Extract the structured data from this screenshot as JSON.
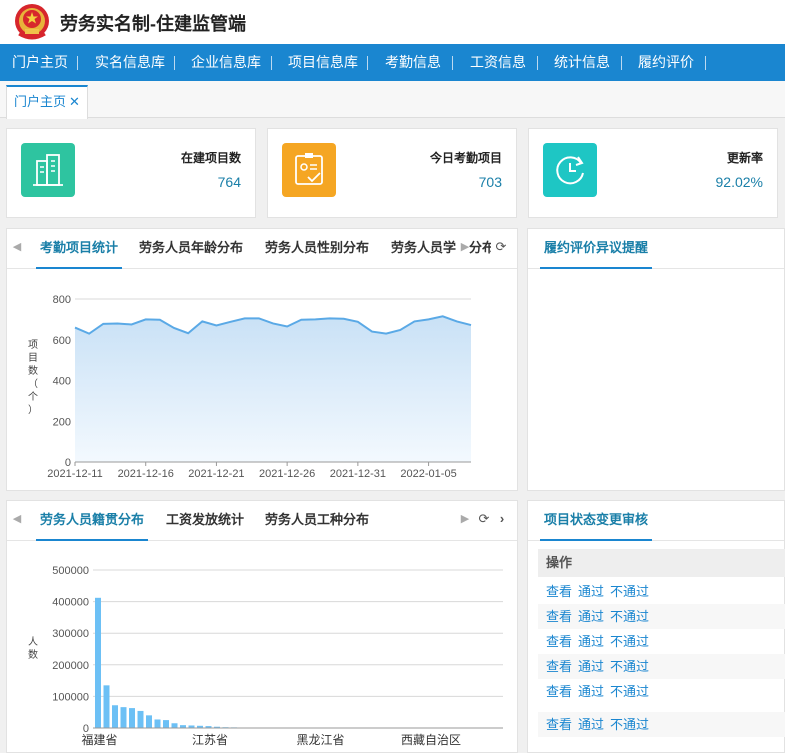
{
  "app": {
    "title": "劳务实名制-住建监管端"
  },
  "nav": {
    "items": [
      "门户主页",
      "实名信息库",
      "企业信息库",
      "项目信息库",
      "考勤信息",
      "工资信息",
      "统计信息",
      "履约评价"
    ]
  },
  "tabs": {
    "open": [
      {
        "label": "门户主页",
        "close": "✕"
      }
    ]
  },
  "stats": [
    {
      "label": "在建项目数",
      "value": "764",
      "icon": "building-icon",
      "color": "#2ec4a0"
    },
    {
      "label": "今日考勤项目",
      "value": "703",
      "icon": "attendance-icon",
      "color": "#f5a623"
    },
    {
      "label": "更新率",
      "value": "92.02%",
      "icon": "refresh-clock-icon",
      "color": "#1ec6c4"
    }
  ],
  "attendance_panel": {
    "tabs": [
      "考勤项目统计",
      "劳务人员年龄分布",
      "劳务人员性别分布",
      "劳务人员学",
      "分布"
    ]
  },
  "dispute_panel": {
    "tabs": [
      "履约评价异议提醒"
    ]
  },
  "origin_panel": {
    "tabs": [
      "劳务人员籍贯分布",
      "工资发放统计",
      "劳务人员工种分布"
    ]
  },
  "audit_panel": {
    "tabs": [
      "项目状态变更审核"
    ],
    "column": "操作",
    "rows": [
      [
        "查看",
        "通过",
        "不通过"
      ],
      [
        "查看",
        "通过",
        "不通过"
      ],
      [
        "查看",
        "通过",
        "不通过"
      ],
      [
        "查看",
        "通过",
        "不通过"
      ],
      [
        "查看",
        "通过",
        "不通过"
      ],
      [
        "查看",
        "通过",
        "不通过"
      ]
    ]
  },
  "chart_data": [
    {
      "type": "area",
      "xlabel": "",
      "ylabel": "项目数（个）",
      "ylim": [
        0,
        800
      ],
      "yticks": [
        0,
        200,
        400,
        600,
        800
      ],
      "xtick_labels": [
        "2021-12-11",
        "2021-12-16",
        "2021-12-21",
        "2021-12-26",
        "2021-12-31",
        "2022-01-05"
      ],
      "x": [
        "2021-12-11",
        "2021-12-12",
        "2021-12-13",
        "2021-12-14",
        "2021-12-15",
        "2021-12-16",
        "2021-12-17",
        "2021-12-18",
        "2021-12-19",
        "2021-12-20",
        "2021-12-21",
        "2021-12-22",
        "2021-12-23",
        "2021-12-24",
        "2021-12-25",
        "2021-12-26",
        "2021-12-27",
        "2021-12-28",
        "2021-12-29",
        "2021-12-30",
        "2021-12-31",
        "2022-01-01",
        "2022-01-02",
        "2022-01-03",
        "2022-01-04",
        "2022-01-05",
        "2022-01-06",
        "2022-01-07",
        "2022-01-08"
      ],
      "values": [
        660,
        630,
        678,
        680,
        675,
        700,
        698,
        658,
        632,
        690,
        670,
        688,
        705,
        705,
        680,
        665,
        698,
        700,
        705,
        703,
        688,
        640,
        630,
        648,
        690,
        700,
        715,
        690,
        672
      ],
      "colors": {
        "line": "#5aa9e6",
        "fill": "#d7eaf9"
      },
      "grid": true
    },
    {
      "type": "bar",
      "xlabel": "",
      "ylabel": "人数",
      "ylim": [
        0,
        500000
      ],
      "yticks": [
        0,
        100000,
        200000,
        300000,
        400000,
        500000
      ],
      "xtick_labels": [
        "福建省",
        "江苏省",
        "黑龙江省",
        "西藏自治区"
      ],
      "values": [
        412000,
        135000,
        72000,
        66000,
        63000,
        54000,
        40000,
        27000,
        25000,
        15000,
        9000,
        8000,
        7000,
        6000,
        4000,
        2500,
        2000,
        1500,
        1000,
        800,
        600,
        400,
        300,
        200,
        150,
        100,
        80,
        60,
        40,
        20,
        10
      ],
      "colors": {
        "bar": "#6cc0f5"
      },
      "grid": true
    }
  ]
}
